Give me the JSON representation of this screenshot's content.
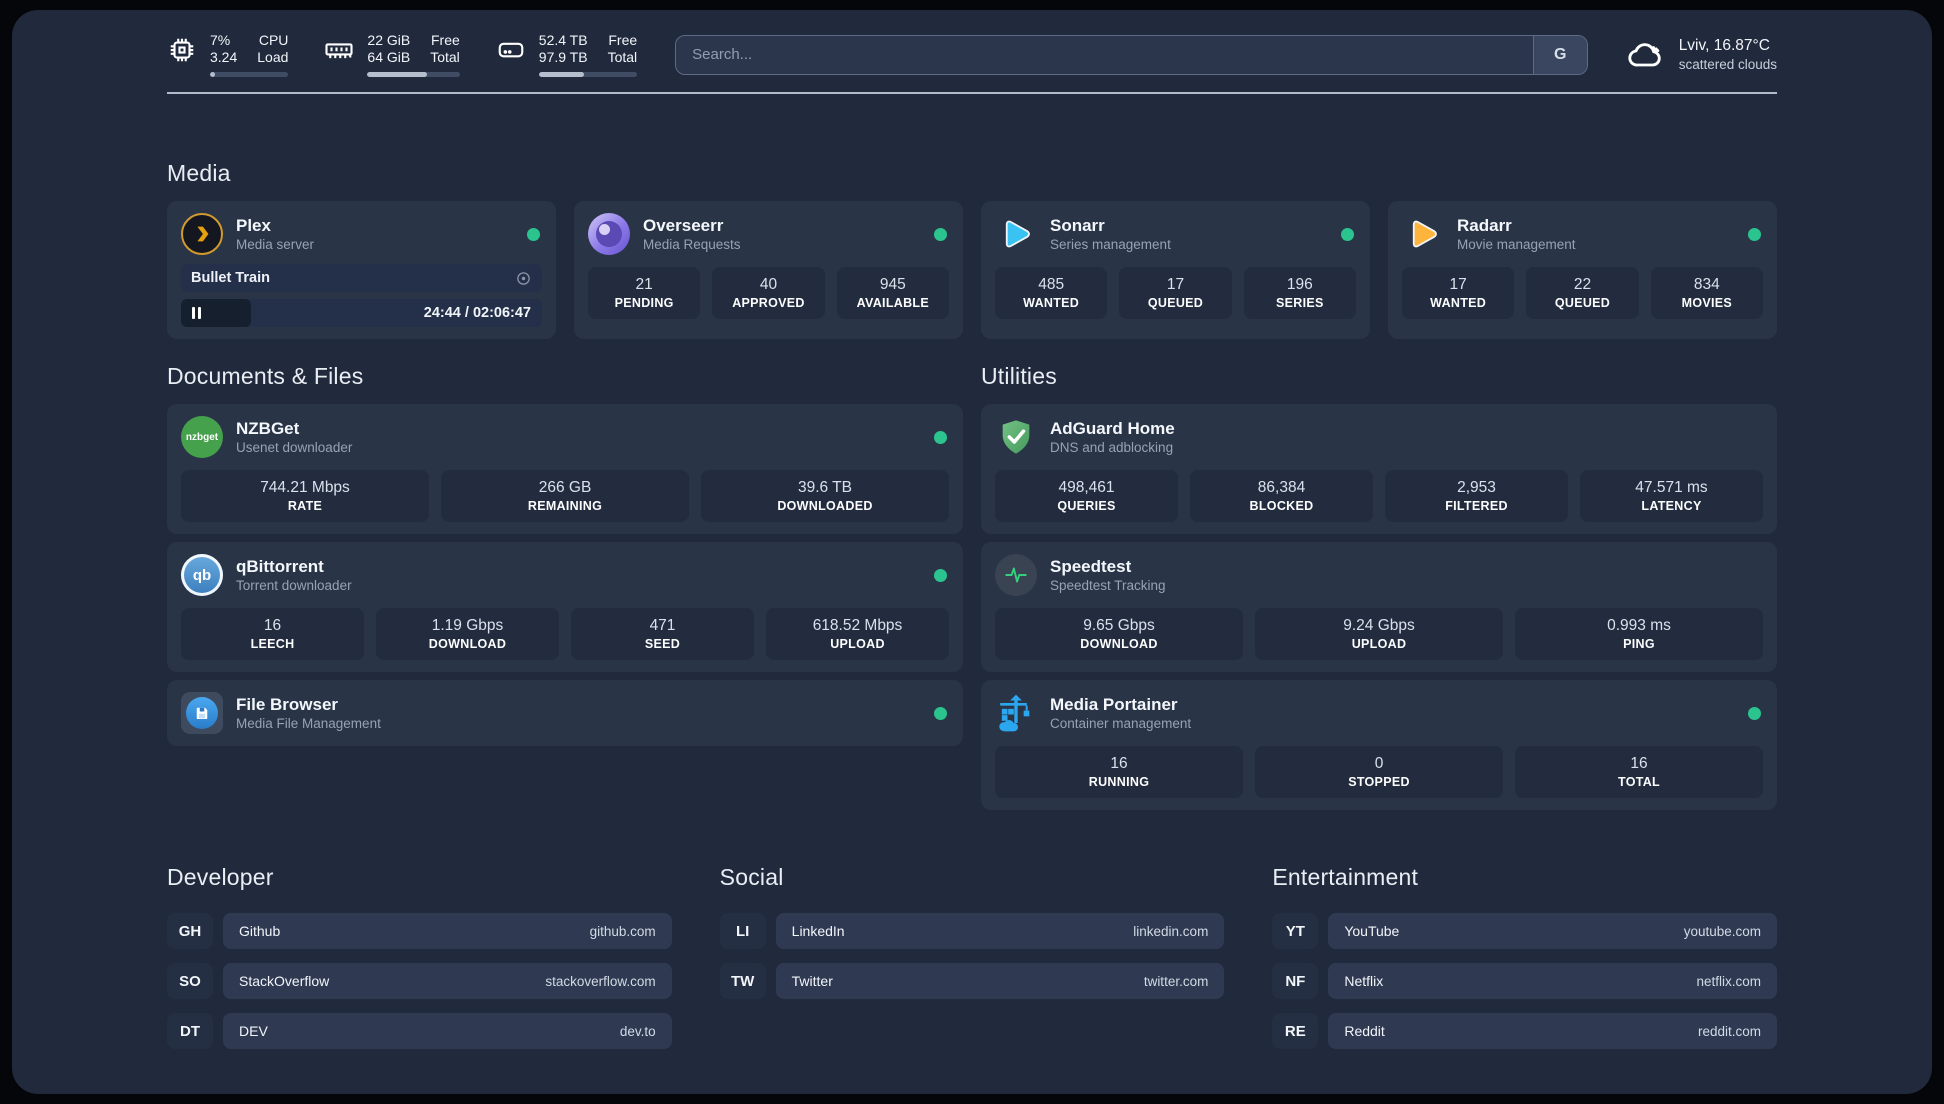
{
  "topbar": {
    "stats": [
      {
        "name": "cpu",
        "values": [
          "7%",
          "3.24"
        ],
        "labels": [
          "CPU",
          "Load"
        ],
        "progress": 7
      },
      {
        "name": "memory",
        "values": [
          "22 GiB",
          "64 GiB"
        ],
        "labels": [
          "Free",
          "Total"
        ],
        "progress": 65
      },
      {
        "name": "disk",
        "values": [
          "52.4 TB",
          "97.9 TB"
        ],
        "labels": [
          "Free",
          "Total"
        ],
        "progress": 46
      }
    ],
    "search": {
      "placeholder": "Search...",
      "provider_button": "G"
    },
    "weather": {
      "location": "Lviv, 16.87°C",
      "condition": "scattered clouds"
    }
  },
  "media": {
    "title": "Media",
    "plex": {
      "title": "Plex",
      "subtitle": "Media server",
      "now_playing": {
        "title": "Bullet Train",
        "time": "24:44 / 02:06:47",
        "progress_percent": 19.5
      }
    },
    "cards": [
      {
        "title": "Overseerr",
        "subtitle": "Media Requests",
        "stats": [
          {
            "value": "21",
            "label": "PENDING"
          },
          {
            "value": "40",
            "label": "APPROVED"
          },
          {
            "value": "945",
            "label": "AVAILABLE"
          }
        ]
      },
      {
        "title": "Sonarr",
        "subtitle": "Series management",
        "stats": [
          {
            "value": "485",
            "label": "WANTED"
          },
          {
            "value": "17",
            "label": "QUEUED"
          },
          {
            "value": "196",
            "label": "SERIES"
          }
        ]
      },
      {
        "title": "Radarr",
        "subtitle": "Movie management",
        "stats": [
          {
            "value": "17",
            "label": "WANTED"
          },
          {
            "value": "22",
            "label": "QUEUED"
          },
          {
            "value": "834",
            "label": "MOVIES"
          }
        ]
      }
    ]
  },
  "documents": {
    "title": "Documents & Files",
    "cards": [
      {
        "title": "NZBGet",
        "subtitle": "Usenet downloader",
        "stats": [
          {
            "value": "744.21 Mbps",
            "label": "RATE"
          },
          {
            "value": "266 GB",
            "label": "REMAINING"
          },
          {
            "value": "39.6 TB",
            "label": "DOWNLOADED"
          }
        ]
      },
      {
        "title": "qBittorrent",
        "subtitle": "Torrent downloader",
        "stats": [
          {
            "value": "16",
            "label": "LEECH"
          },
          {
            "value": "1.19 Gbps",
            "label": "DOWNLOAD"
          },
          {
            "value": "471",
            "label": "SEED"
          },
          {
            "value": "618.52 Mbps",
            "label": "UPLOAD"
          }
        ]
      },
      {
        "title": "File Browser",
        "subtitle": "Media File Management",
        "stats": []
      }
    ]
  },
  "utilities": {
    "title": "Utilities",
    "cards": [
      {
        "title": "AdGuard Home",
        "subtitle": "DNS and adblocking",
        "stats": [
          {
            "value": "498,461",
            "label": "QUERIES"
          },
          {
            "value": "86,384",
            "label": "BLOCKED"
          },
          {
            "value": "2,953",
            "label": "FILTERED"
          },
          {
            "value": "47.571 ms",
            "label": "LATENCY"
          }
        ]
      },
      {
        "title": "Speedtest",
        "subtitle": "Speedtest Tracking",
        "stats": [
          {
            "value": "9.65 Gbps",
            "label": "DOWNLOAD"
          },
          {
            "value": "9.24 Gbps",
            "label": "UPLOAD"
          },
          {
            "value": "0.993 ms",
            "label": "PING"
          }
        ]
      },
      {
        "title": "Media Portainer",
        "subtitle": "Container management",
        "stats": [
          {
            "value": "16",
            "label": "RUNNING"
          },
          {
            "value": "0",
            "label": "STOPPED"
          },
          {
            "value": "16",
            "label": "TOTAL"
          }
        ]
      }
    ]
  },
  "bookmarks": {
    "groups": [
      {
        "title": "Developer",
        "items": [
          {
            "abbr": "GH",
            "name": "Github",
            "url": "github.com"
          },
          {
            "abbr": "SO",
            "name": "StackOverflow",
            "url": "stackoverflow.com"
          },
          {
            "abbr": "DT",
            "name": "DEV",
            "url": "dev.to"
          }
        ]
      },
      {
        "title": "Social",
        "items": [
          {
            "abbr": "LI",
            "name": "LinkedIn",
            "url": "linkedin.com"
          },
          {
            "abbr": "TW",
            "name": "Twitter",
            "url": "twitter.com"
          }
        ]
      },
      {
        "title": "Entertainment",
        "items": [
          {
            "abbr": "YT",
            "name": "YouTube",
            "url": "youtube.com"
          },
          {
            "abbr": "NF",
            "name": "Netflix",
            "url": "netflix.com"
          },
          {
            "abbr": "RE",
            "name": "Reddit",
            "url": "reddit.com"
          }
        ]
      }
    ]
  },
  "colors": {
    "status_online": "#2bc48e",
    "sonarr_accent": "#39c3f2",
    "radarr_accent": "#ffb53c",
    "plex_accent": "#e5a00d"
  }
}
